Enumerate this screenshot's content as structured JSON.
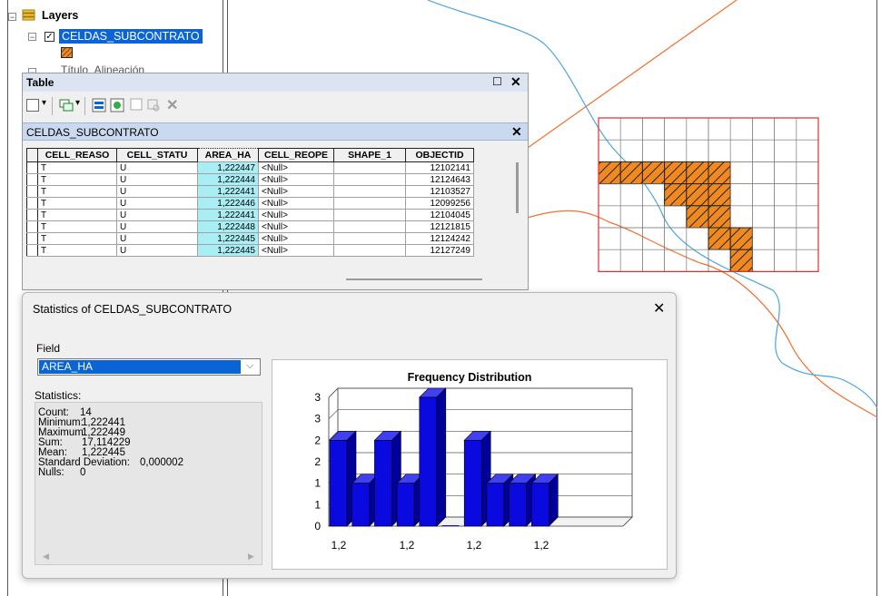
{
  "toc": {
    "root_label": "Layers",
    "layer_label": "CELDAS_SUBCONTRATO",
    "next_layer_partial": "Título_Alineación"
  },
  "table_window": {
    "title": "Table",
    "tab_label": "CELDAS_SUBCONTRATO",
    "columns": [
      "CELL_REASO",
      "CELL_STATU",
      "AREA_HA",
      "CELL_REOPE",
      "SHAPE_1",
      "OBJECTID"
    ],
    "rows": [
      [
        "T",
        "U",
        "1,222447",
        "<Null>",
        "",
        "12102141"
      ],
      [
        "T",
        "U",
        "1,222444",
        "<Null>",
        "",
        "12124643"
      ],
      [
        "T",
        "U",
        "1,222441",
        "<Null>",
        "",
        "12103527"
      ],
      [
        "T",
        "U",
        "1,222446",
        "<Null>",
        "",
        "12099256"
      ],
      [
        "T",
        "U",
        "1,222441",
        "<Null>",
        "",
        "12104045"
      ],
      [
        "T",
        "U",
        "1,222448",
        "<Null>",
        "",
        "12121815"
      ],
      [
        "T",
        "U",
        "1,222445",
        "<Null>",
        "",
        "12124242"
      ],
      [
        "T",
        "U",
        "1,222445",
        "<Null>",
        "",
        "12127249"
      ]
    ]
  },
  "stats_dialog": {
    "title": "Statistics of CELDAS_SUBCONTRATO",
    "field_label": "Field",
    "field_value": "AREA_HA",
    "statistics_label": "Statistics:",
    "lines": [
      {
        "label": "Count:",
        "value": "14"
      },
      {
        "label": "Minimum:",
        "value": "1,222441"
      },
      {
        "label": "Maximum:",
        "value": "1,222449"
      },
      {
        "label": "Sum:",
        "value": "17,114229"
      },
      {
        "label": "Mean:",
        "value": "1,222445"
      },
      {
        "label": "Standard Deviation:",
        "value": "0,000002"
      },
      {
        "label": "Nulls:",
        "value": "0"
      }
    ]
  },
  "chart_data": {
    "type": "bar",
    "title": "Frequency Distribution",
    "xlabel": "",
    "ylabel": "",
    "values": [
      2,
      1,
      2,
      1,
      3,
      0,
      2,
      1,
      1,
      1
    ],
    "y_tick_labels": [
      "0",
      "1",
      "1",
      "2",
      "2",
      "3",
      "3"
    ],
    "x_tick_labels": [
      "1,2",
      "1,2",
      "1,2",
      "1,2"
    ],
    "ylim": [
      0,
      3
    ],
    "bar_color": "#0a0ae0",
    "grid": true
  },
  "map": {
    "river_color": "#4aa3e0",
    "road_color": "#f07030",
    "cell_border_color": "#e03030",
    "hatch_color": "#f08a20"
  }
}
